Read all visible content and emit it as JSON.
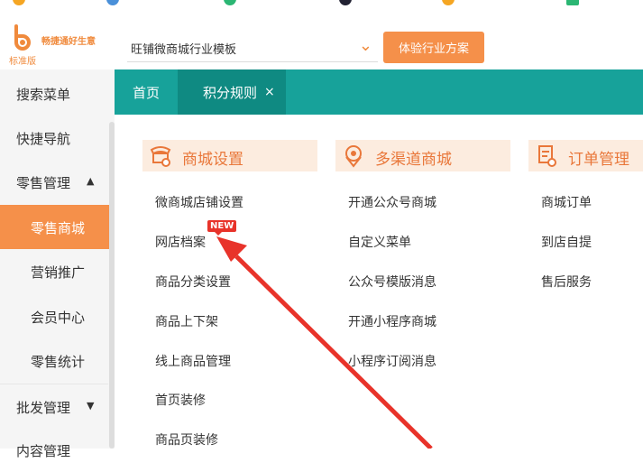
{
  "brand": {
    "name": "畅捷通好生意",
    "edition": "标准版"
  },
  "header": {
    "industry_select": "旺铺微商城行业模板",
    "experience_button": "体验行业方案"
  },
  "sidebar": {
    "items": [
      {
        "label": "搜索菜单"
      },
      {
        "label": "快捷导航"
      },
      {
        "label": "零售管理",
        "expanded": true
      },
      {
        "label": "零售商城",
        "active": true
      },
      {
        "label": "营销推广"
      },
      {
        "label": "会员中心"
      },
      {
        "label": "零售统计"
      },
      {
        "label": "批发管理",
        "expanded": false
      },
      {
        "label": "内容管理"
      }
    ]
  },
  "tabs": [
    {
      "label": "首页"
    },
    {
      "label": "积分规则",
      "active": true,
      "close": "×"
    }
  ],
  "columns": [
    {
      "title": "商城设置",
      "icon": "shop-settings-icon",
      "links": [
        "微商城店铺设置",
        "网店档案",
        "商品分类设置",
        "商品上下架",
        "线上商品管理",
        "首页装修",
        "商品页装修"
      ]
    },
    {
      "title": "多渠道商城",
      "icon": "multichannel-icon",
      "links": [
        "开通公众号商城",
        "自定义菜单",
        "公众号模版消息",
        "开通小程序商城",
        "小程序订阅消息"
      ]
    },
    {
      "title": "订单管理",
      "icon": "order-icon",
      "links": [
        "商城订单",
        "到店自提",
        "售后服务"
      ]
    }
  ],
  "new_badge": "NEW",
  "colors": {
    "accent": "#f5904a",
    "teal": "#17a29a",
    "arrow": "#e8332a"
  }
}
